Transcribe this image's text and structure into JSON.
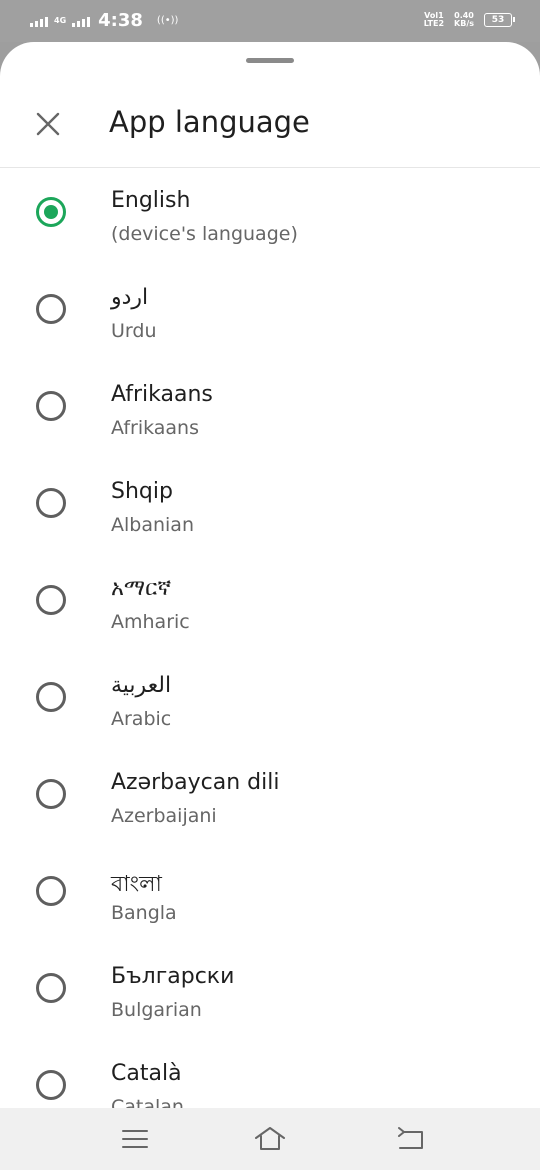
{
  "status_bar": {
    "network": "4G",
    "time": "4:38",
    "volte": "Vol1",
    "lte": "LTE2",
    "speed_value": "0.40",
    "speed_unit": "KB/s",
    "battery": "53"
  },
  "sheet": {
    "title": "App language",
    "languages": [
      {
        "native": "English",
        "english": "(device's language)",
        "selected": true
      },
      {
        "native": "اردو",
        "english": "Urdu",
        "selected": false
      },
      {
        "native": "Afrikaans",
        "english": "Afrikaans",
        "selected": false
      },
      {
        "native": "Shqip",
        "english": "Albanian",
        "selected": false
      },
      {
        "native": "አማርኛ",
        "english": "Amharic",
        "selected": false
      },
      {
        "native": "العربية",
        "english": "Arabic",
        "selected": false
      },
      {
        "native": "Azərbaycan dili",
        "english": "Azerbaijani",
        "selected": false
      },
      {
        "native": "বাংলা",
        "english": "Bangla",
        "selected": false
      },
      {
        "native": "Български",
        "english": "Bulgarian",
        "selected": false
      },
      {
        "native": "Català",
        "english": "Catalan",
        "selected": false
      }
    ]
  },
  "colors": {
    "accent": "#1ca65a",
    "radio_unchecked": "#5f5f5f"
  },
  "icons": {
    "close": "close-icon",
    "menu": "menu-icon",
    "home": "home-icon",
    "back": "back-icon"
  }
}
